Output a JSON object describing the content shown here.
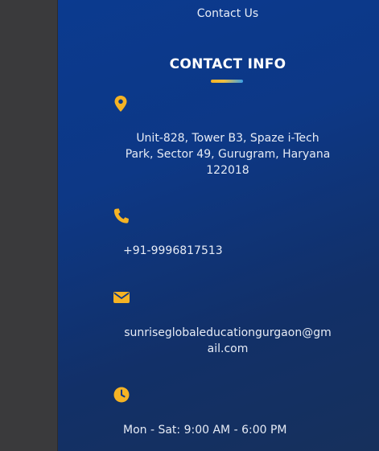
{
  "nav": {
    "contact_link": "Contact Us"
  },
  "contact_info": {
    "heading": "CONTACT INFO",
    "address": "Unit-828, Tower B3, Spaze i-Tech Park, Sector 49, Gurugram, Haryana 122018",
    "phone": "+91-9996817513",
    "email": "sunriseglobaleducationgurgaon@gmail.com",
    "hours": "Mon - Sat: 9:00 AM - 6:00 PM"
  },
  "icons": {
    "address": "map-marker-icon",
    "phone": "phone-icon",
    "email": "envelope-icon",
    "hours": "clock-icon"
  },
  "colors": {
    "accent": "#f5b324",
    "panel_background": "#0d3886",
    "sidebar_background": "#3a3a3c",
    "text": "#ffffff"
  }
}
